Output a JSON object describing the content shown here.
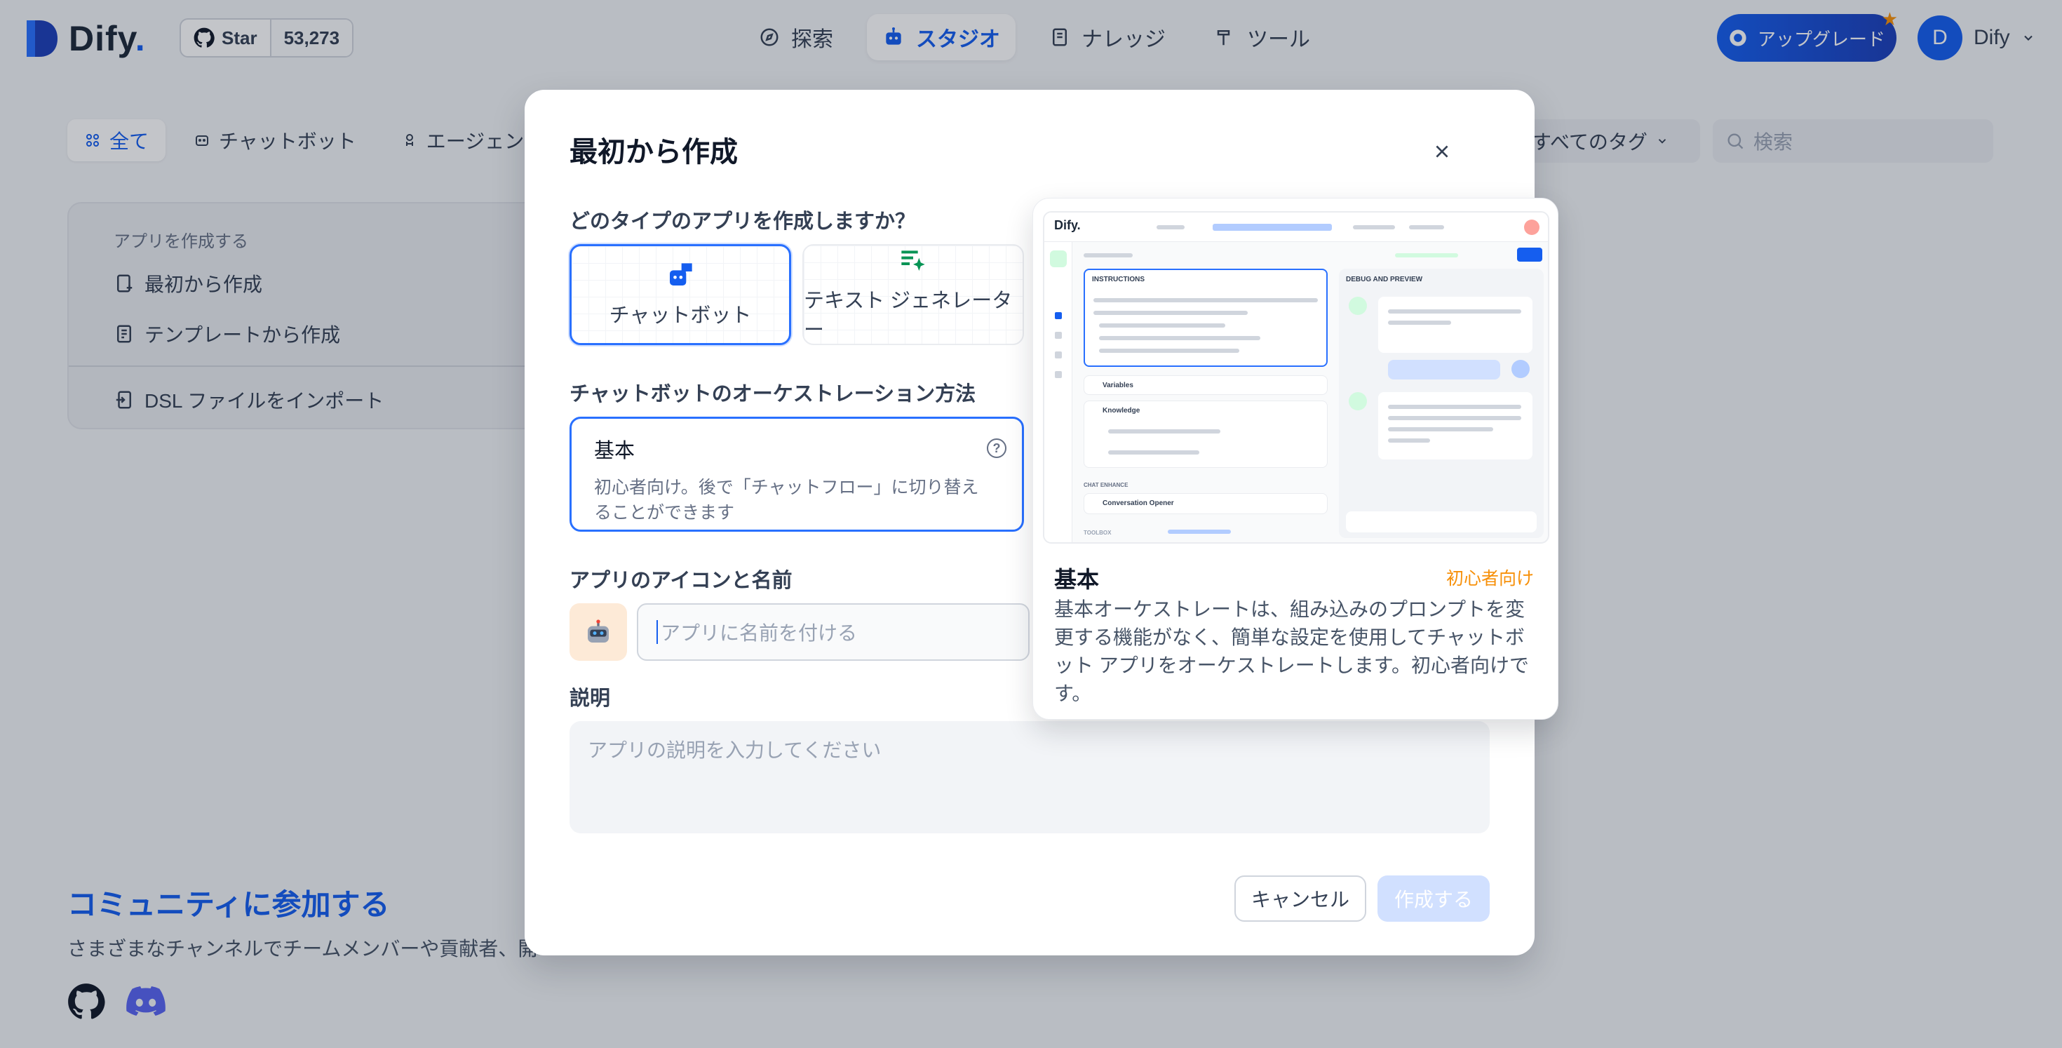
{
  "header": {
    "logo_text": "Dify",
    "logo_suffix": ".",
    "github": {
      "label": "Star",
      "count": "53,273"
    },
    "nav": [
      {
        "label": "探索",
        "icon": "compass-icon"
      },
      {
        "label": "スタジオ",
        "icon": "robot-icon",
        "active": true
      },
      {
        "label": "ナレッジ",
        "icon": "book-icon"
      },
      {
        "label": "ツール",
        "icon": "hammer-icon"
      }
    ],
    "upgrade_label": "アップグレード",
    "user": {
      "initial": "D",
      "name": "Dify"
    }
  },
  "filters": {
    "items": [
      {
        "label": "全て",
        "active": true
      },
      {
        "label": "チャットボット"
      },
      {
        "label": "エージェント"
      }
    ],
    "tag_filter": "すべてのタグ",
    "search_placeholder": "検索"
  },
  "create_card": {
    "header": "アプリを作成する",
    "from_scratch": "最初から作成",
    "from_template": "テンプレートから作成",
    "import_dsl": "DSL ファイルをインポート"
  },
  "community": {
    "title": "コミュニティに参加する",
    "subtitle": "さまざまなチャンネルでチームメンバーや貢献者、開"
  },
  "modal": {
    "title": "最初から作成",
    "type_question": "どのタイプのアプリを作成しますか？",
    "types": [
      {
        "label": "チャットボット",
        "selected": true
      },
      {
        "label": "テキスト ジェネレーター"
      }
    ],
    "orchestration_label": "チャットボットのオーケストレーション方法",
    "orchestration": {
      "title": "基本",
      "description": "初心者向け。後で「チャットフロー」に切り替えることができます"
    },
    "icon_name_label": "アプリのアイコンと名前",
    "name_placeholder": "アプリに名前を付ける",
    "description_label": "説明",
    "description_placeholder": "アプリの説明を入力してください",
    "cancel_label": "キャンセル",
    "create_label": "作成する"
  },
  "preview": {
    "title": "基本",
    "badge": "初心者向け",
    "description": "基本オーケストレートは、組み込みのプロンプトを変更する機能がなく、簡単な設定を使用してチャットボット アプリをオーケストレートします。初心者向けです。",
    "mock": {
      "logo": "Dify.",
      "instructions": "INSTRUCTIONS",
      "debug": "DEBUG AND PREVIEW",
      "variables": "Variables",
      "knowledge": "Knowledge",
      "chat_enhance": "CHAT ENHANCE",
      "opener": "Conversation Opener",
      "toolbox": "TOOLBOX"
    }
  },
  "colors": {
    "primary": "#155eef",
    "accent_orange": "#f79009",
    "app_icon_bg": "#fdead7"
  }
}
